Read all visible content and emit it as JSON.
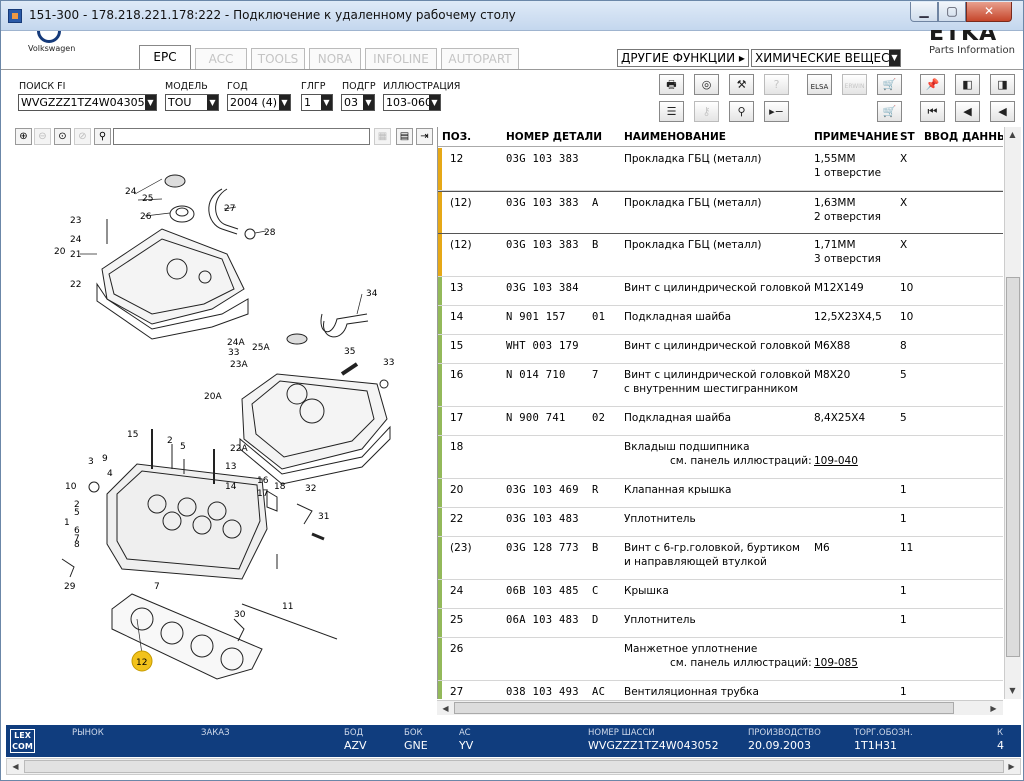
{
  "window": {
    "title": "151-300 - 178.218.221.178:222 - Подключение к удаленному рабочему столу",
    "min": "▁",
    "max": "▢",
    "close": "✕"
  },
  "brand": {
    "vw": "Volkswagen",
    "etka": "ETKA",
    "parts": "Parts Information"
  },
  "tabs": [
    "EPC",
    "ACC",
    "TOOLS",
    "NORA",
    "INFOLINE",
    "AUTOPART"
  ],
  "functions": {
    "other": "ДРУГИЕ ФУНКЦИИ ▸",
    "chemical": "ХИМИЧЕСКИЕ ВЕЩЕСТВА"
  },
  "filters": {
    "fi": {
      "label": "ПОИСК FI",
      "value": "WVGZZZ1TZ4W043052"
    },
    "model": {
      "label": "МОДЕЛЬ",
      "value": "TOU"
    },
    "year": {
      "label": "ГОД",
      "value": "2004 (4)"
    },
    "hg": {
      "label": "ГЛГР",
      "value": "1"
    },
    "sg": {
      "label": "ПОДГР",
      "value": "03"
    },
    "illus": {
      "label": "ИЛЛЮСТРАЦИЯ",
      "value": "103-060"
    }
  },
  "toolbar": {
    "elsa": "ELSA",
    "erwin": "ERWIN"
  },
  "grid": {
    "headers": {
      "pos": "ПОЗ.",
      "part": "НОМЕР ДЕТАЛИ",
      "name": "НАИМЕНОВАНИЕ",
      "note": "ПРИМЕЧАНИЕ",
      "st": "ST",
      "input": "ВВОД ДАННЫХ"
    },
    "rows": [
      {
        "pos": "12",
        "part": "03G  103  383",
        "suffix": "",
        "name": "Прокладка ГБЦ (металл)",
        "name2": "",
        "note": "1,55ММ",
        "note2": "1 отверстие",
        "st": "X",
        "color": "#e6a817"
      },
      {
        "pos": "(12)",
        "part": "03G  103  383",
        "suffix": "A",
        "name": "Прокладка ГБЦ (металл)",
        "name2": "",
        "note": "1,63ММ",
        "note2": "2 отверстия",
        "st": "X",
        "color": "#e6a817"
      },
      {
        "pos": "(12)",
        "part": "03G  103  383",
        "suffix": "B",
        "name": "Прокладка ГБЦ (металл)",
        "name2": "",
        "note": "1,71ММ",
        "note2": "3 отверстия",
        "st": "X",
        "color": "#e6a817"
      },
      {
        "pos": "13",
        "part": "03G  103  384",
        "suffix": "",
        "name": "Винт с цилиндрической головкой",
        "name2": "",
        "note": "M12X149",
        "note2": "",
        "st": "10",
        "color": "#93b95a"
      },
      {
        "pos": "14",
        "part": "N    901  157",
        "suffix": "01",
        "name": "Подкладная шайба",
        "name2": "",
        "note": "12,5X23X4,5",
        "note2": "",
        "st": "10",
        "color": "#93b95a"
      },
      {
        "pos": "15",
        "part": "WHT  003  179",
        "suffix": "",
        "name": "Винт с цилиндрической головкой",
        "name2": "",
        "note": "M6X88",
        "note2": "",
        "st": "8",
        "color": "#93b95a"
      },
      {
        "pos": "16",
        "part": "N    014  710",
        "suffix": "7",
        "name": "Винт с цилиндрической головкой",
        "name2": "с внутренним шестигранником",
        "note": "M8X20",
        "note2": "",
        "st": "5",
        "color": "#93b95a"
      },
      {
        "pos": "17",
        "part": "N    900  741",
        "suffix": "02",
        "name": "Подкладная шайба",
        "name2": "",
        "note": "8,4X25X4",
        "note2": "",
        "st": "5",
        "color": "#93b95a"
      },
      {
        "pos": "18",
        "part": "",
        "suffix": "",
        "name": "Вкладыш подшипника",
        "name2": "см. панель иллюстраций:",
        "note": "",
        "note2": "109-040",
        "st": "",
        "color": "#93b95a"
      },
      {
        "pos": "20",
        "part": "03G  103  469",
        "suffix": "R",
        "name": "Клапанная крышка",
        "name2": "",
        "note": "",
        "note2": "",
        "st": "1",
        "color": "#93b95a"
      },
      {
        "pos": "22",
        "part": "03G  103  483",
        "suffix": "",
        "name": "Уплотнитель",
        "name2": "",
        "note": "",
        "note2": "",
        "st": "1",
        "color": "#93b95a"
      },
      {
        "pos": "(23)",
        "part": "03G  128  773",
        "suffix": "B",
        "name": "Винт с 6-гр.головкой, буртиком",
        "name2": "и направляющей втулкой",
        "note": "M6",
        "note2": "",
        "st": "11",
        "color": "#93b95a"
      },
      {
        "pos": "24",
        "part": "06B  103  485",
        "suffix": "C",
        "name": "Крышка",
        "name2": "",
        "note": "",
        "note2": "",
        "st": "1",
        "color": "#93b95a"
      },
      {
        "pos": "25",
        "part": "06A  103  483",
        "suffix": "D",
        "name": "Уплотнитель",
        "name2": "",
        "note": "",
        "note2": "",
        "st": "1",
        "color": "#93b95a"
      },
      {
        "pos": "26",
        "part": "",
        "suffix": "",
        "name": "Манжетное уплотнение",
        "name2": "см. панель иллюстраций:",
        "note": "",
        "note2": "109-085",
        "st": "",
        "color": "#93b95a"
      },
      {
        "pos": "27",
        "part": "038  103  493",
        "suffix": "AC",
        "name": "Вентиляционная трубка",
        "name2": "",
        "note": "",
        "note2": "",
        "st": "1",
        "color": "#93b95a"
      }
    ]
  },
  "illustration": {
    "callouts": [
      "24",
      "25",
      "26",
      "27",
      "28",
      "23",
      "24",
      "21",
      "20",
      "22",
      "34",
      "24A",
      "33",
      "25A",
      "23A",
      "35",
      "33",
      "20A",
      "22A",
      "15",
      "2",
      "5",
      "3",
      "9",
      "4",
      "10",
      "1",
      "2",
      "6",
      "7",
      "8",
      "13",
      "14",
      "16",
      "17",
      "18",
      "32",
      "31",
      "29",
      "7",
      "30",
      "11",
      "12"
    ]
  },
  "status": {
    "lexcom": "LEX COM",
    "market": {
      "label": "РЫНОК",
      "value": ""
    },
    "order": {
      "label": "ЗАКАЗ",
      "value": ""
    },
    "bod": {
      "label": "БОД",
      "value": "AZV"
    },
    "bok": {
      "label": "БОК",
      "value": "GNE"
    },
    "ac": {
      "label": "AC",
      "value": "YV"
    },
    "chassis": {
      "label": "НОМЕР ШАССИ",
      "value": "WVGZZZ1TZ4W043052"
    },
    "prod": {
      "label": "ПРОИЗВОДСТВО",
      "value": "20.09.2003"
    },
    "trade": {
      "label": "ТОРГ.ОБОЗН.",
      "value": "1T1H31"
    },
    "k": {
      "label": "К",
      "value": "4"
    }
  }
}
